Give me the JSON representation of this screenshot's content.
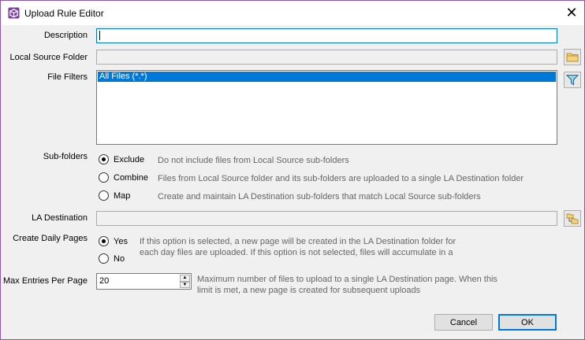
{
  "window": {
    "title": "Upload Rule Editor",
    "close_glyph": "✕"
  },
  "labels": {
    "description": "Description",
    "local_source": "Local Source Folder",
    "file_filters": "File Filters",
    "subfolders": "Sub-folders",
    "la_destination": "LA Destination",
    "create_daily": "Create Daily Pages",
    "max_entries": "Max Entries Per Page"
  },
  "fields": {
    "description_value": "",
    "local_source_value": "",
    "la_destination_value": "",
    "max_entries_value": "20"
  },
  "file_filters": {
    "items": [
      "All Files (*.*)"
    ],
    "selected_index": 0
  },
  "subfolders": {
    "selected": "exclude",
    "options": [
      {
        "label": "Exclude",
        "desc": "Do not include files from Local Source sub-folders"
      },
      {
        "label": "Combine",
        "desc": "Files from Local Source folder and its sub-folders are uploaded to a single LA Destination folder"
      },
      {
        "label": "Map",
        "desc": "Create and maintain LA Destination sub-folders that match Local Source sub-folders"
      }
    ]
  },
  "daily_pages": {
    "selected": "yes",
    "yes_label": "Yes",
    "no_label": "No",
    "desc_line1": "If this option is selected, a new page will be created in the LA Destination folder for",
    "desc_line2": "each day files are uploaded. If this option is not selected, files will accumulate in a"
  },
  "max_entries": {
    "desc_line1": "Maximum number of files to upload to a single LA Destination page. When this",
    "desc_line2": "limit is met, a new page is created for subsequent uploads"
  },
  "buttons": {
    "cancel": "Cancel",
    "ok": "OK"
  },
  "icons": {
    "app": "app-cube-icon",
    "folder": "folder-icon",
    "filter": "filter-funnel-icon",
    "destination": "folder-tree-icon"
  },
  "colors": {
    "accent": "#0078d7",
    "window_border": "#8a57a8",
    "dialog_bg": "#f0f0f0"
  }
}
